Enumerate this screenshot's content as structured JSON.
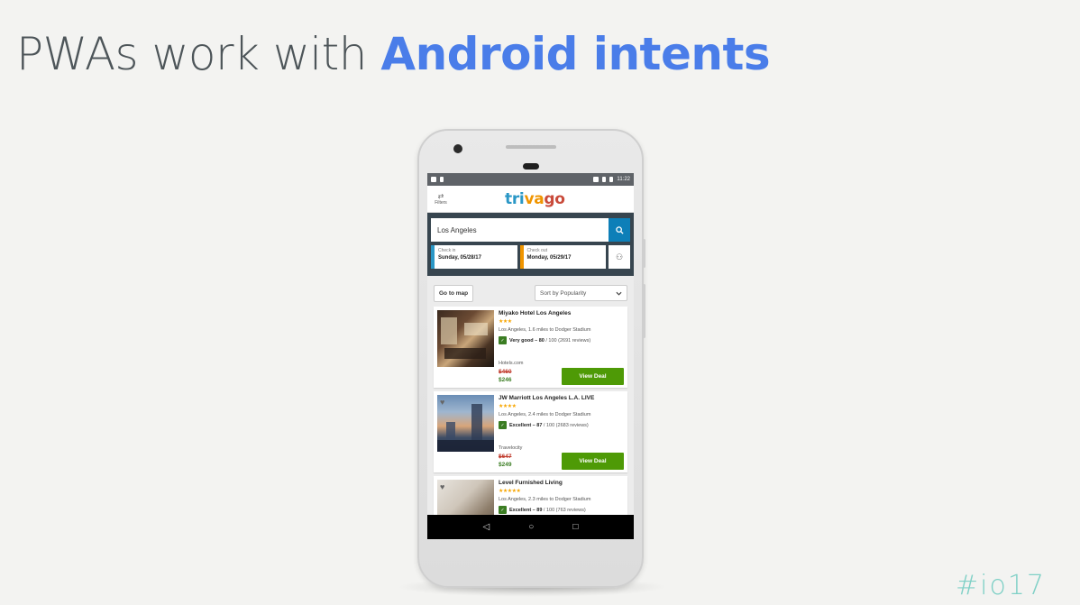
{
  "slide": {
    "title_prefix": "PWAs work with ",
    "title_accent": "Android intents",
    "corner_logo": "#io17"
  },
  "statusbar": {
    "time": "11:22"
  },
  "app": {
    "filters_label": "Filters",
    "logo": {
      "part1": "tri",
      "part2": "va",
      "part3": "go"
    },
    "search": {
      "value": "Los Angeles"
    },
    "check_in": {
      "label": "Check in",
      "value": "Sunday, 05/28/17"
    },
    "check_out": {
      "label": "Check out",
      "value": "Monday, 05/29/17"
    },
    "go_to_map": "Go to map",
    "sort": "Sort by Popularity"
  },
  "hotels": [
    {
      "name": "Miyako Hotel Los Angeles",
      "stars": "★★★",
      "location": "Los Angeles, 1.6 miles to Dodger Stadium",
      "rating_label": "Very good – 80",
      "rating_rest": " / 100 (2691 reviews)",
      "site": "Hotels.com",
      "old_price": "$460",
      "new_price": "$246",
      "cta": "View Deal"
    },
    {
      "name": "JW Marriott Los Angeles L.A. LIVE",
      "stars": "★★★★",
      "location": "Los Angeles, 2.4 miles to Dodger Stadium",
      "rating_label": "Excellent – 87",
      "rating_rest": " / 100 (2683 reviews)",
      "site": "Travelocity",
      "old_price": "$647",
      "new_price": "$249",
      "cta": "View Deal"
    },
    {
      "name": "Level Furnished Living",
      "stars": "★★★★★",
      "location": "Los Angeles, 2.3 miles to Dodger Stadium",
      "rating_label": "Excellent – 89",
      "rating_rest": " / 100 (763 reviews)"
    }
  ],
  "colors": {
    "accent": "#4a7de9",
    "view_deal": "#4e9a06",
    "search_button": "#0d7fb8",
    "search_panel": "#37454f"
  },
  "icons": [
    "filters-icon",
    "search-icon",
    "guests-icon",
    "chevron-down-icon",
    "heart-icon",
    "back-icon",
    "home-icon",
    "recents-icon"
  ]
}
